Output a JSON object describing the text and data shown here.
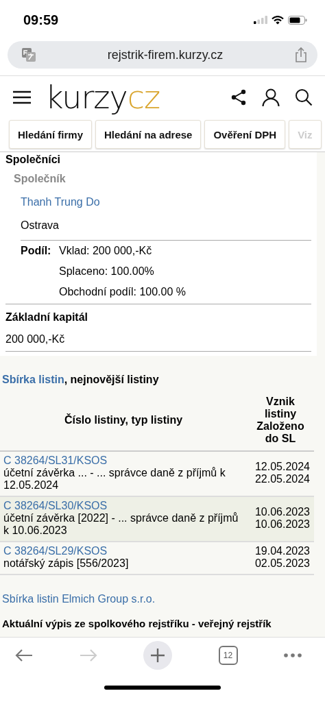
{
  "status_bar": {
    "time": "09:59"
  },
  "url_bar": {
    "url": "rejstrik-firem.kurzy.cz"
  },
  "header": {
    "logo_main": "kurzy",
    "logo_accent": "cz"
  },
  "nav_tabs": [
    {
      "label": "Hledání firmy",
      "faded": false
    },
    {
      "label": "Hledání na adrese",
      "faded": false
    },
    {
      "label": "Ověření DPH",
      "faded": false
    },
    {
      "label": "Viz",
      "faded": true
    }
  ],
  "partners": {
    "heading": "Společníci",
    "subheading": "Společník",
    "name": "Thanh Trung Do",
    "city": "Ostrava",
    "share_label": "Podíl:",
    "share_lines": [
      "Vklad: 200 000,-Kč",
      "Splaceno: 100.00%",
      "Obchodní podíl: 100.00 %"
    ]
  },
  "capital": {
    "heading": "Základní kapitál",
    "value": "200 000,-Kč"
  },
  "documents": {
    "title_link": "Sbírka listin",
    "title_rest": ", nejnovější listiny",
    "columns": [
      "Číslo listiny, typ listiny",
      "Vznik listiny Založeno do SL"
    ],
    "rows": [
      {
        "number": "C 38264/SL31/KSOS",
        "description": "účetní závěrka ... - ... správce daně z příjmů k 12.05.2024",
        "created": "12.05.2024",
        "filed": "22.05.2024",
        "shaded": false
      },
      {
        "number": "C 38264/SL30/KSOS",
        "description": "účetní závěrka [2022] - ... správce daně z příjmů k 10.06.2023",
        "created": "10.06.2023",
        "filed": "10.06.2023",
        "shaded": true
      },
      {
        "number": "C 38264/SL29/KSOS",
        "description": "notářský zápis [556/2023]",
        "created": "19.04.2023",
        "filed": "02.05.2023",
        "shaded": false
      }
    ],
    "all_link": "Sbírka listin Elmich Group s.r.o."
  },
  "next_heading": "Aktuální výpis ze spolkového rejstříku - veřejný rejstřík",
  "toolbar": {
    "tab_count": "12"
  }
}
